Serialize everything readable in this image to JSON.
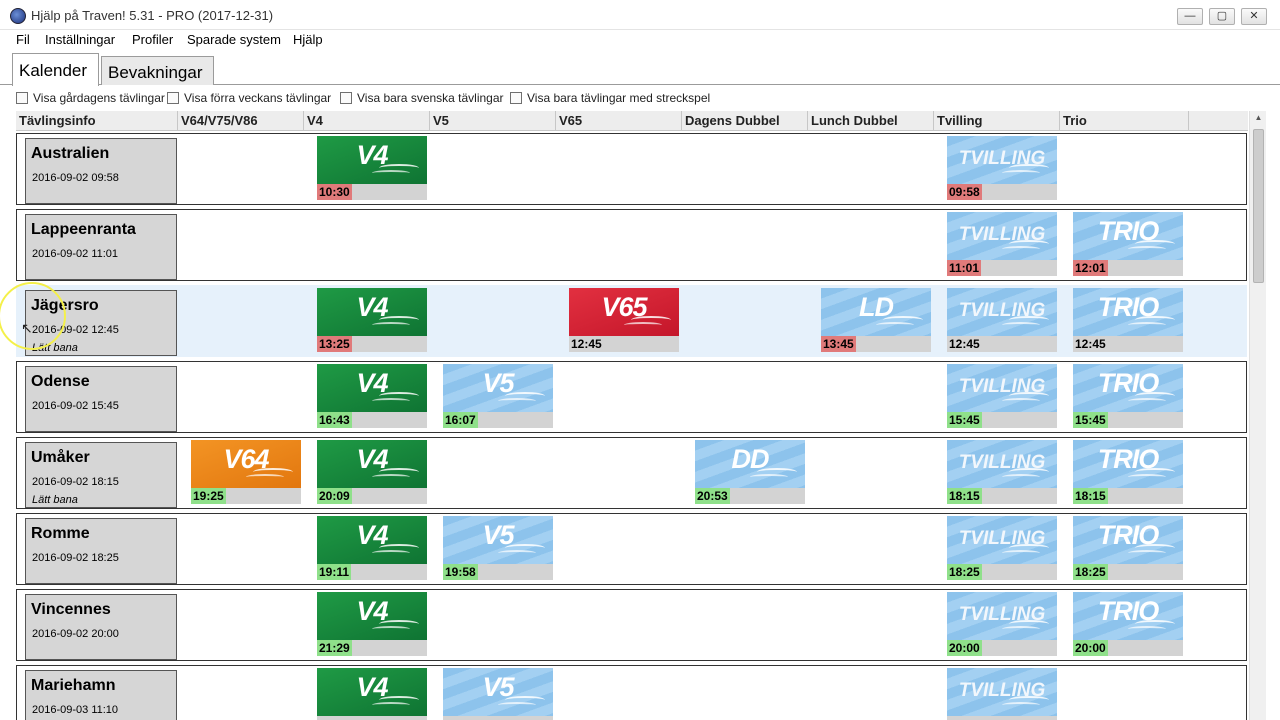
{
  "window": {
    "title": "Hjälp på Traven! 5.31 - PRO (2017-12-31)",
    "minimize": "—",
    "maximize": "▢",
    "close": "✕"
  },
  "menu": [
    "Fil",
    "Inställningar",
    "Profiler",
    "Sparade system",
    "Hjälp"
  ],
  "tabs": [
    "Kalender",
    "Bevakningar"
  ],
  "filters": [
    "Visa gårdagens tävlingar",
    "Visa förra veckans tävlingar",
    "Visa bara svenska tävlingar",
    "Visa bara tävlingar med streckspel"
  ],
  "columns": [
    "Tävlingsinfo",
    "V64/V75/V86",
    "V4",
    "V5",
    "V65",
    "Dagens Dubbel",
    "Lunch Dubbel",
    "Tvilling",
    "Trio"
  ],
  "colors": {
    "green": "#1f9a45",
    "red": "#e23040",
    "orange": "#f39424",
    "light": "#8dc3ec",
    "time_red": "#e07a7a",
    "time_green": "#8fe08a",
    "selected_row": "#e6f1fb"
  },
  "rows": [
    {
      "track": "Australien",
      "date": "2016-09-02 09:58",
      "note": "",
      "games": [
        {
          "col": 2,
          "label": "V4",
          "style": "green",
          "time": "10:30",
          "status": "red"
        },
        {
          "col": 7,
          "label": "TVILLING",
          "style": "light",
          "time": "09:58",
          "status": "red"
        }
      ]
    },
    {
      "track": "Lappeenranta",
      "date": "2016-09-02 11:01",
      "note": "",
      "games": [
        {
          "col": 7,
          "label": "TVILLING",
          "style": "light",
          "time": "11:01",
          "status": "red"
        },
        {
          "col": 8,
          "label": "TRIO",
          "style": "light",
          "time": "12:01",
          "status": "red"
        }
      ]
    },
    {
      "track": "Jägersro",
      "date": "2016-09-02 12:45",
      "note": "Lätt bana",
      "selected": true,
      "games": [
        {
          "col": 2,
          "label": "V4",
          "style": "green",
          "time": "13:25",
          "status": "red"
        },
        {
          "col": 4,
          "label": "V65",
          "style": "red",
          "time": "12:45",
          "status": "none"
        },
        {
          "col": 6,
          "label": "LD",
          "style": "light",
          "time": "13:45",
          "status": "red"
        },
        {
          "col": 7,
          "label": "TVILLING",
          "style": "light",
          "time": "12:45",
          "status": "none"
        },
        {
          "col": 8,
          "label": "TRIO",
          "style": "light",
          "time": "12:45",
          "status": "none"
        }
      ]
    },
    {
      "track": "Odense",
      "date": "2016-09-02 15:45",
      "note": "",
      "games": [
        {
          "col": 2,
          "label": "V4",
          "style": "green",
          "time": "16:43",
          "status": "green"
        },
        {
          "col": 3,
          "label": "V5",
          "style": "light",
          "time": "16:07",
          "status": "green"
        },
        {
          "col": 7,
          "label": "TVILLING",
          "style": "light",
          "time": "15:45",
          "status": "green"
        },
        {
          "col": 8,
          "label": "TRIO",
          "style": "light",
          "time": "15:45",
          "status": "green"
        }
      ]
    },
    {
      "track": "Umåker",
      "date": "2016-09-02 18:15",
      "note": "Lätt bana",
      "games": [
        {
          "col": 1,
          "label": "V64",
          "style": "orange",
          "time": "19:25",
          "status": "green"
        },
        {
          "col": 2,
          "label": "V4",
          "style": "green",
          "time": "20:09",
          "status": "green"
        },
        {
          "col": 5,
          "label": "DD",
          "style": "light",
          "time": "20:53",
          "status": "green"
        },
        {
          "col": 7,
          "label": "TVILLING",
          "style": "light",
          "time": "18:15",
          "status": "green"
        },
        {
          "col": 8,
          "label": "TRIO",
          "style": "light",
          "time": "18:15",
          "status": "green"
        }
      ]
    },
    {
      "track": "Romme",
      "date": "2016-09-02 18:25",
      "note": "",
      "games": [
        {
          "col": 2,
          "label": "V4",
          "style": "green",
          "time": "19:11",
          "status": "green"
        },
        {
          "col": 3,
          "label": "V5",
          "style": "light",
          "time": "19:58",
          "status": "green"
        },
        {
          "col": 7,
          "label": "TVILLING",
          "style": "light",
          "time": "18:25",
          "status": "green"
        },
        {
          "col": 8,
          "label": "TRIO",
          "style": "light",
          "time": "18:25",
          "status": "green"
        }
      ]
    },
    {
      "track": "Vincennes",
      "date": "2016-09-02 20:00",
      "note": "",
      "games": [
        {
          "col": 2,
          "label": "V4",
          "style": "green",
          "time": "21:29",
          "status": "green"
        },
        {
          "col": 7,
          "label": "TVILLING",
          "style": "light",
          "time": "20:00",
          "status": "green"
        },
        {
          "col": 8,
          "label": "TRIO",
          "style": "light",
          "time": "20:00",
          "status": "green"
        }
      ]
    },
    {
      "track": "Mariehamn",
      "date": "2016-09-03 11:10",
      "note": "",
      "games": [
        {
          "col": 2,
          "label": "V4",
          "style": "green",
          "time": "",
          "status": "none"
        },
        {
          "col": 3,
          "label": "V5",
          "style": "light",
          "time": "",
          "status": "none"
        },
        {
          "col": 7,
          "label": "TVILLING",
          "style": "light",
          "time": "",
          "status": "none"
        }
      ]
    }
  ]
}
